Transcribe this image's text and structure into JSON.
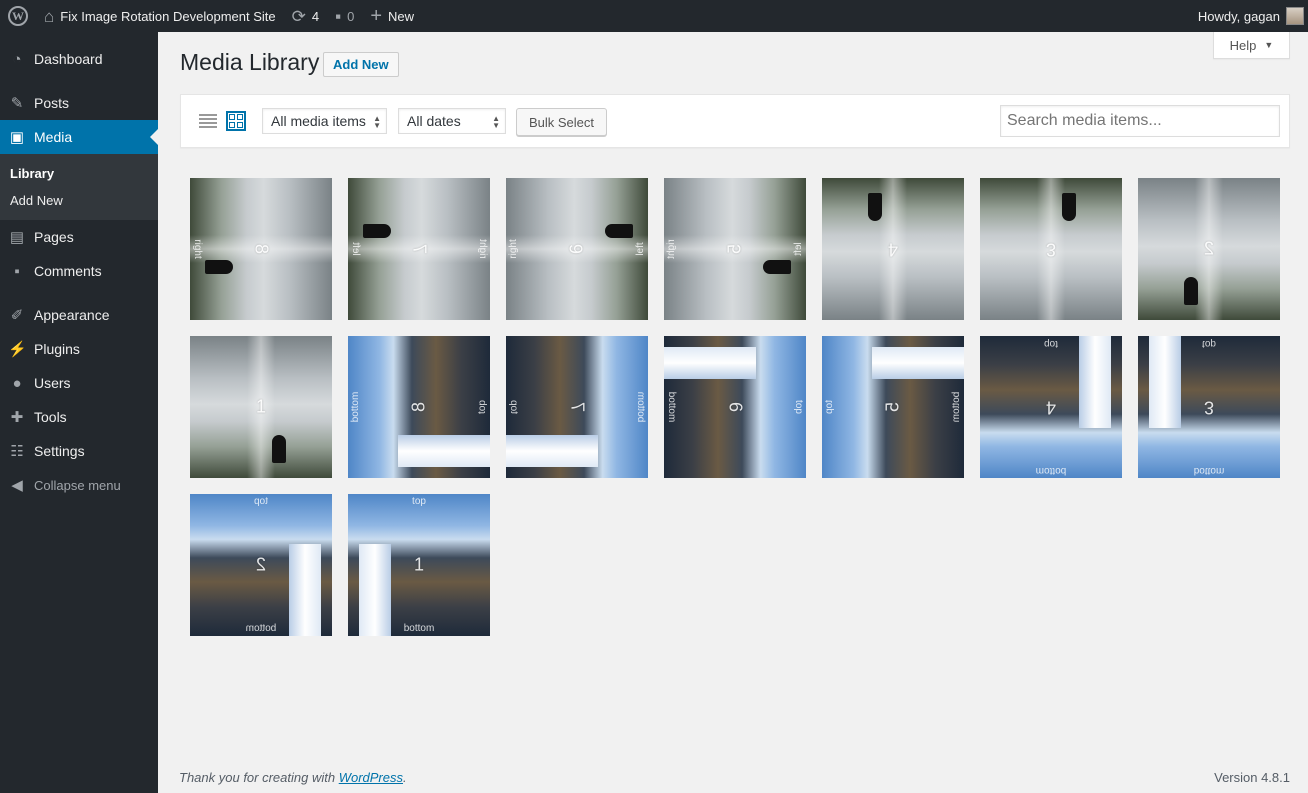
{
  "adminbar": {
    "wp_logo_icon": "wordpress-logo-icon",
    "site_name": "Fix Image Rotation Development Site",
    "updates_count": "4",
    "comments_count": "0",
    "new_label": "New",
    "greeting": "Howdy, gagan"
  },
  "sidebar": {
    "items": [
      {
        "label": "Dashboard",
        "icon": "dashboard-icon"
      },
      {
        "label": "Posts",
        "icon": "pin-icon"
      },
      {
        "label": "Media",
        "icon": "media-icon"
      },
      {
        "label": "Pages",
        "icon": "pages-icon"
      },
      {
        "label": "Comments",
        "icon": "comments-icon"
      },
      {
        "label": "Appearance",
        "icon": "appearance-icon"
      },
      {
        "label": "Plugins",
        "icon": "plugins-icon"
      },
      {
        "label": "Users",
        "icon": "users-icon"
      },
      {
        "label": "Tools",
        "icon": "tools-icon"
      },
      {
        "label": "Settings",
        "icon": "settings-icon"
      }
    ],
    "media_submenu": [
      "Library",
      "Add New"
    ],
    "collapse_label": "Collapse menu"
  },
  "help_tab": {
    "label": "Help"
  },
  "header": {
    "title": "Media Library",
    "add_new": "Add New"
  },
  "toolbar": {
    "filter_type": "All media items",
    "filter_date": "All dates",
    "bulk_select": "Bulk Select",
    "search_placeholder": "Search media items..."
  },
  "media_items": [
    {
      "number": "8",
      "top": "",
      "bottom": "right"
    },
    {
      "number": "7",
      "top": "right",
      "bottom": "left"
    },
    {
      "number": "6",
      "top": "right",
      "bottom": "left"
    },
    {
      "number": "5",
      "top": "right",
      "bottom": "left"
    },
    {
      "number": "4",
      "top": "",
      "bottom": ""
    },
    {
      "number": "3",
      "top": "",
      "bottom": ""
    },
    {
      "number": "2",
      "top": "",
      "bottom": ""
    },
    {
      "number": "1",
      "top": "",
      "bottom": ""
    },
    {
      "number": "8",
      "top": "bottom",
      "bottom": "top"
    },
    {
      "number": "7",
      "top": "bottom",
      "bottom": "top"
    },
    {
      "number": "6",
      "top": "top",
      "bottom": "bottom"
    },
    {
      "number": "5",
      "top": "top",
      "bottom": "bottom"
    },
    {
      "number": "4",
      "top": "bottom",
      "bottom": "top"
    },
    {
      "number": "3",
      "top": "bottom",
      "bottom": "top"
    },
    {
      "number": "2",
      "top": "top",
      "bottom": "bottom"
    },
    {
      "number": "1",
      "top": "top",
      "bottom": "bottom"
    }
  ],
  "footer": {
    "thanks_text": "Thank you for creating with ",
    "thanks_link": "WordPress",
    "thanks_end": ".",
    "version": "Version 4.8.1"
  }
}
